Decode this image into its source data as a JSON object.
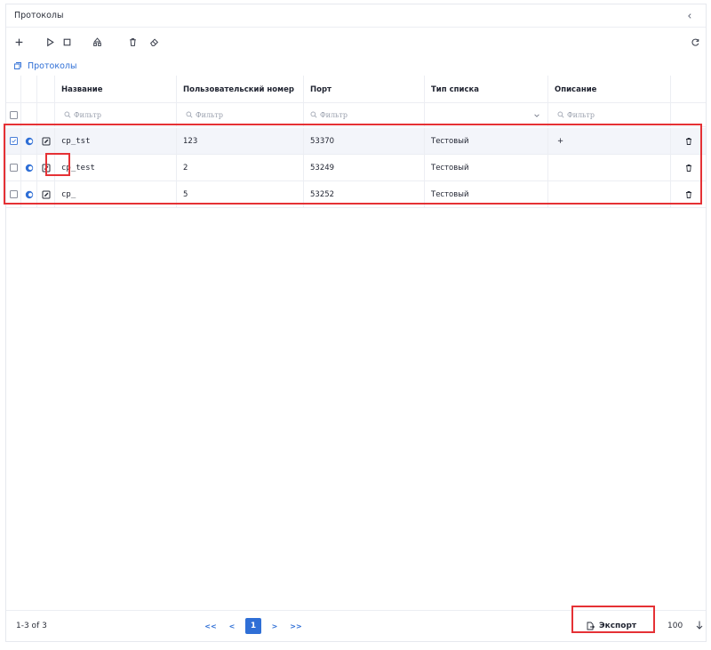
{
  "panel": {
    "title": "Протоколы"
  },
  "breadcrumb": {
    "label": "Протоколы"
  },
  "table": {
    "columns": [
      {
        "key": "name",
        "label": "Название"
      },
      {
        "key": "user_number",
        "label": "Пользовательский номер"
      },
      {
        "key": "port",
        "label": "Порт"
      },
      {
        "key": "list_type",
        "label": "Тип списка"
      },
      {
        "key": "description",
        "label": "Описание"
      }
    ],
    "filter_placeholder": "Фильтр",
    "rows": [
      {
        "name": "cp_tst",
        "user_number": "123",
        "port": "53370",
        "list_type": "Тестовый",
        "description": "+",
        "checked": true
      },
      {
        "name": "cp_test",
        "user_number": "2",
        "port": "53249",
        "list_type": "Тестовый",
        "description": "",
        "checked": false
      },
      {
        "name": "cp_",
        "user_number": "5",
        "port": "53252",
        "list_type": "Тестовый",
        "description": "",
        "checked": false
      }
    ]
  },
  "footer": {
    "range": "1-3 of 3",
    "pager": {
      "first": "<<",
      "prev": "<",
      "current": "1",
      "next": ">",
      "last": ">>"
    },
    "export_label": "Экспорт",
    "page_size": "100"
  },
  "colors": {
    "accent": "#2f6fd6",
    "highlight": "#e53135"
  }
}
